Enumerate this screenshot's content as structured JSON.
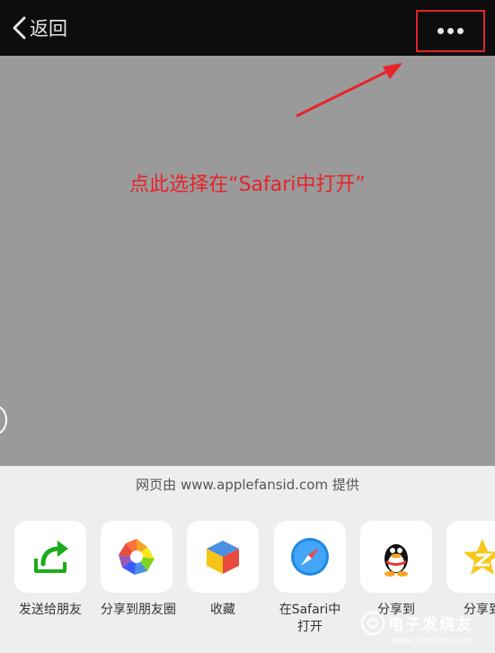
{
  "nav": {
    "back_label": "返回",
    "more_icon": "ellipsis-icon"
  },
  "annotation": {
    "text": "点此选择在“Safari中打开”",
    "color": "#e8232a"
  },
  "sheet": {
    "provider_text": "网页由 www.applefansid.com 提供",
    "items": [
      {
        "label": "发送给朋友",
        "icon": "send-to-friend-icon"
      },
      {
        "label": "分享到朋友圈",
        "icon": "moments-icon"
      },
      {
        "label": "收藏",
        "icon": "favorites-icon"
      },
      {
        "label": "在Safari中\n打开",
        "icon": "safari-icon"
      },
      {
        "label": "分享到",
        "icon": "qq-icon"
      },
      {
        "label": "分享到",
        "icon": "qzone-icon"
      }
    ]
  },
  "watermark": {
    "name": "电子发烧友",
    "url": "www.elecfans.com"
  },
  "colors": {
    "topbar": "#0d0d0d",
    "webview": "#9a9a9a",
    "sheet": "#eeeeee",
    "highlight_box": "#e02525"
  }
}
